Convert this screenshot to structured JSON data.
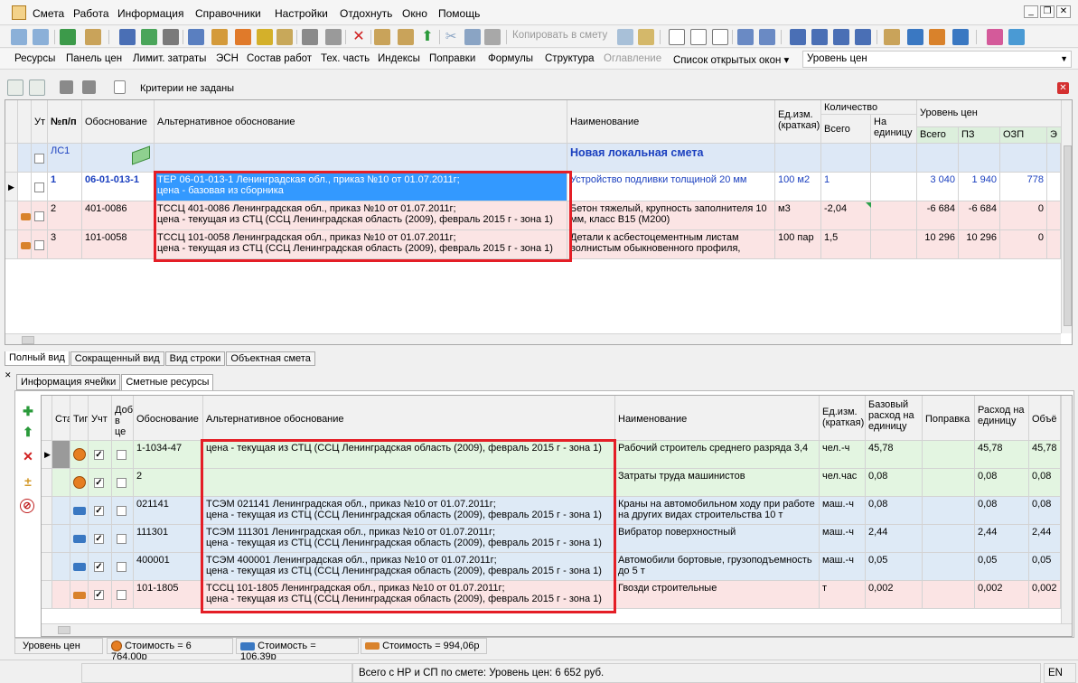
{
  "menu": {
    "items": [
      "Смета",
      "Работа",
      "Информация",
      "Справочники",
      "Настройки",
      "Отдохнуть",
      "Окно",
      "Помощь"
    ]
  },
  "toolbar": {
    "copy_label": "Копировать в смету"
  },
  "linkbar": {
    "items": [
      "Ресурсы",
      "Панель цен",
      "Лимит. затраты",
      "ЭСН",
      "Состав работ",
      "Тех. часть",
      "Индексы",
      "Поправки",
      "Формулы",
      "Структура"
    ],
    "disabled_item": "Оглавление",
    "open_windows": "Список открытых окон",
    "price_level": "Уровень цен"
  },
  "criteria": {
    "text": "Критерии не заданы"
  },
  "upper_grid": {
    "headers": {
      "ut": "Ут",
      "num": "№п/п",
      "basis": "Обоснование",
      "alt": "Альтернативное обоснование",
      "name": "Наименование",
      "unit": "Ед.изм. (краткая)",
      "qty": "Количество",
      "qty_total": "Всего",
      "qty_unit": "На единицу",
      "level": "Уровень цен",
      "level_total": "Всего",
      "pz": "ПЗ",
      "ozp": "ОЗП",
      "e": "Э"
    },
    "rows": [
      {
        "num": "ЛС1",
        "basis": "",
        "alt": "",
        "name": "Новая локальная смета",
        "unit": "",
        "qty_total": "",
        "qty_unit": "",
        "total": "",
        "pz": "",
        "ozp": ""
      },
      {
        "num": "1",
        "basis": "06-01-013-1",
        "alt1": "ТЕР 06-01-013-1 Ленинградская обл., приказ №10 от 01.07.2011г;",
        "alt2": "цена - базовая из сборника",
        "name": "Устройство подливки толщиной 20 мм",
        "unit": "100 м2",
        "qty_total": "1",
        "total": "3 040",
        "pz": "1 940",
        "ozp": "778"
      },
      {
        "num": "2",
        "basis": "401-0086",
        "alt1": "ТССЦ 401-0086 Ленинградская обл., приказ №10 от 01.07.2011г;",
        "alt2": "цена - текущая из СТЦ (ССЦ Ленинградская область (2009), февраль 2015 г - зона 1)",
        "name": "Бетон тяжелый, крупность заполнителя 10 мм, класс В15 (М200)",
        "unit": "м3",
        "qty_total": "-2,04",
        "total": "-6 684",
        "pz": "-6 684",
        "ozp": "0"
      },
      {
        "num": "3",
        "basis": "101-0058",
        "alt1": "ТССЦ 101-0058 Ленинградская обл., приказ №10 от 01.07.2011г;",
        "alt2": "цена - текущая из СТЦ (ССЦ Ленинградская область (2009), февраль 2015 г - зона 1)",
        "name": "Детали к асбестоцементным листам волнистым обыкновенного профиля,",
        "unit": "100 пар",
        "qty_total": "1,5",
        "total": "10 296",
        "pz": "10 296",
        "ozp": "0"
      }
    ]
  },
  "view_tabs": [
    "Полный вид",
    "Сокращенный вид",
    "Вид строки",
    "Объектная смета"
  ],
  "lower_tabs": [
    "Информация ячейки",
    "Сметные ресурсы"
  ],
  "lower_grid": {
    "headers": {
      "st": "Ста",
      "type": "Тип",
      "uch": "Учт",
      "dob": "Доб в це",
      "basis": "Обоснование",
      "alt": "Альтернативное обоснование",
      "name": "Наименование",
      "unit": "Ед.изм. (краткая)",
      "base_rate": "Базовый расход на единицу",
      "corr": "Поправка",
      "rate": "Расход на единицу",
      "vol": "Объё"
    },
    "rows": [
      {
        "icon": "worker",
        "basis": "1-1034-47",
        "alt1": "цена - текущая из СТЦ (ССЦ Ленинградская область (2009), февраль 2015 г - зона 1)",
        "alt2": "",
        "name": "Рабочий строитель среднего разряда 3,4",
        "unit": "чел.-ч",
        "base": "45,78",
        "rate": "45,78",
        "vol": "45,78"
      },
      {
        "icon": "worker",
        "basis": "2",
        "alt1": "",
        "alt2": "",
        "name": "Затраты труда машинистов",
        "unit": "чел.час",
        "base": "0,08",
        "rate": "0,08",
        "vol": "0,08"
      },
      {
        "icon": "car",
        "basis": "021141",
        "alt1": "ТСЭМ 021141 Ленинградская обл., приказ №10 от 01.07.2011г;",
        "alt2": "цена - текущая из СТЦ (ССЦ Ленинградская область (2009), февраль 2015 г - зона 1)",
        "name": "Краны на автомобильном ходу при работе на других видах строительства 10 т",
        "unit": "маш.-ч",
        "base": "0,08",
        "rate": "0,08",
        "vol": "0,08"
      },
      {
        "icon": "car",
        "basis": "111301",
        "alt1": "ТСЭМ 111301 Ленинградская обл., приказ №10 от 01.07.2011г;",
        "alt2": "цена - текущая из СТЦ (ССЦ Ленинградская область (2009), февраль 2015 г - зона 1)",
        "name": "Вибратор поверхностный",
        "unit": "маш.-ч",
        "base": "2,44",
        "rate": "2,44",
        "vol": "2,44"
      },
      {
        "icon": "car",
        "basis": "400001",
        "alt1": "ТСЭМ 400001 Ленинградская обл., приказ №10 от 01.07.2011г;",
        "alt2": "цена - текущая из СТЦ (ССЦ Ленинградская область (2009), февраль 2015 г - зона 1)",
        "name": "Автомобили бортовые, грузоподъемность до 5 т",
        "unit": "маш.-ч",
        "base": "0,05",
        "rate": "0,05",
        "vol": "0,05"
      },
      {
        "icon": "brick",
        "basis": "101-1805",
        "alt1": "ТССЦ 101-1805 Ленинградская обл., приказ №10 от 01.07.2011г;",
        "alt2": "цена - текущая из СТЦ (ССЦ Ленинградская область (2009), февраль 2015 г - зона 1)",
        "name": "Гвозди строительные",
        "unit": "т",
        "base": "0,002",
        "rate": "0,002",
        "vol": "0,002"
      }
    ]
  },
  "status": {
    "level": "Уровень цен",
    "cost_workers": "Стоимость = 6 764,00р",
    "cost_machines": "Стоимость = 106,39р",
    "cost_materials": "Стоимость = 994,06р"
  },
  "bottom": {
    "total": "Всего с НР и СП по смете: Уровень цен: 6 652 руб.",
    "lang": "EN"
  },
  "colors": {
    "highlight_red": "#e41e26",
    "selected_blue": "#3399ff",
    "row_pink": "#fbe4e4",
    "row_green": "#e3f5e1",
    "row_blue": "#deeaf6",
    "estimate_blue": "#dde8f6"
  }
}
